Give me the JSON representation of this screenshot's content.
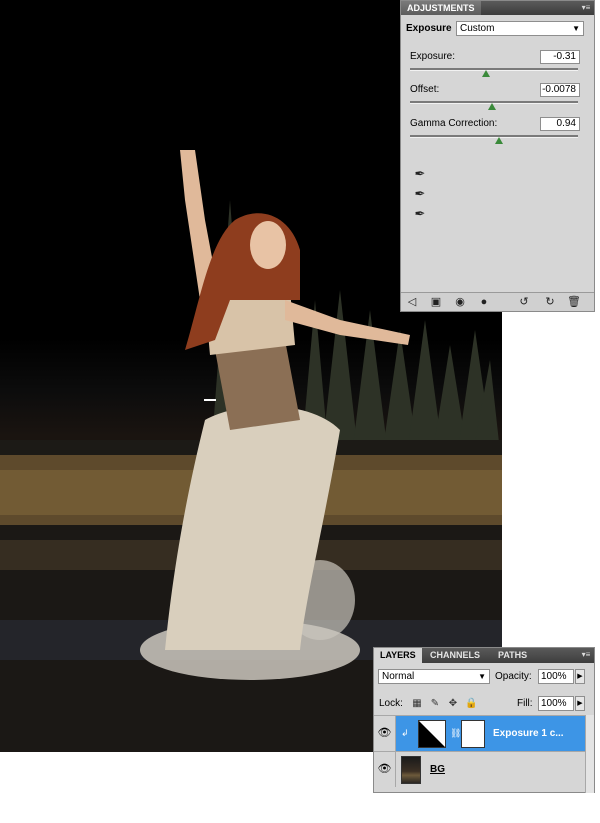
{
  "adjustments_panel": {
    "tab_label": "ADJUSTMENTS",
    "title": "Exposure",
    "preset": "Custom",
    "sliders": [
      {
        "label": "Exposure:",
        "value": "-0.31",
        "position": 0.45
      },
      {
        "label": "Offset:",
        "value": "-0.0078",
        "position": 0.49
      },
      {
        "label": "Gamma Correction:",
        "value": "0.94",
        "position": 0.53
      }
    ],
    "icons": {
      "panel_menu": "panel-menu-icon",
      "eyedroppers": [
        "black-point-eyedropper-icon",
        "gray-point-eyedropper-icon",
        "white-point-eyedropper-icon"
      ],
      "footer": [
        "return-to-list-icon",
        "expanded-view-icon",
        "clip-to-layer-icon",
        "visibility-icon",
        "view-previous-state-icon",
        "reset-icon",
        "delete-icon"
      ]
    }
  },
  "layers_panel": {
    "tabs": [
      "LAYERS",
      "CHANNELS",
      "PATHS"
    ],
    "active_tab": "LAYERS",
    "blend_mode": "Normal",
    "opacity_label": "Opacity:",
    "opacity_value": "100%",
    "lock_label": "Lock:",
    "fill_label": "Fill:",
    "fill_value": "100%",
    "layers": [
      {
        "name": "Exposure 1 c...",
        "selected": true
      },
      {
        "name": "BG",
        "selected": false
      }
    ]
  },
  "colors": {
    "panel_bg": "#d6d6d6",
    "tabbar": "#3d3d3d",
    "selection_blue": "#3d95e6",
    "slider_thumb": "#3a8a3a"
  }
}
